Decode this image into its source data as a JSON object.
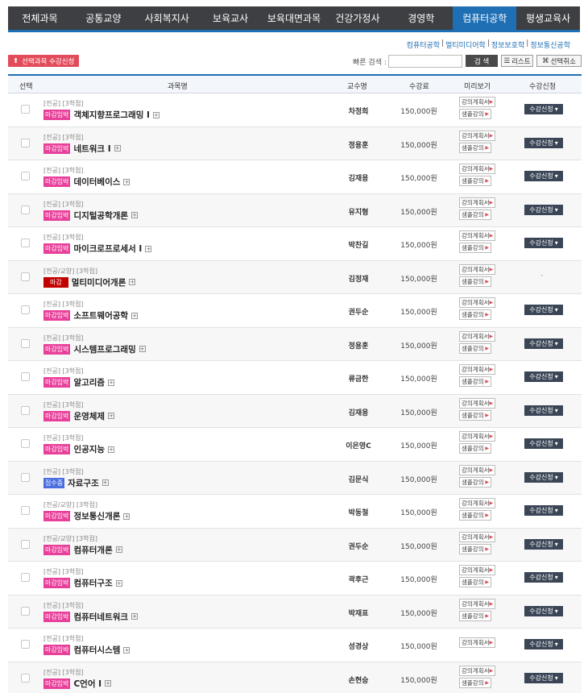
{
  "nav": {
    "tabs": [
      "전체과목",
      "공통교양",
      "사회복지사",
      "보육교사",
      "보육대면과목",
      "건강가정사",
      "경영학",
      "컴퓨터공학",
      "평생교육사"
    ],
    "active_index": 7
  },
  "subnav": {
    "links": [
      "컴퓨터공학",
      "멀티미디어학",
      "정보보호학",
      "정보통신공학"
    ]
  },
  "toolbar": {
    "enroll_selected_label": "선택과목 수강신청",
    "quick_search_label": "빠른 검색 :",
    "quick_search_value": "",
    "search_label": "검 색",
    "list_label": "리스트",
    "deselect_label": "선택취소"
  },
  "table": {
    "headers": {
      "select": "선택",
      "course": "과목명",
      "professor": "교수명",
      "fee": "수강료",
      "preview": "미리보기",
      "enroll": "수강신청"
    },
    "preview_labels": {
      "plan": "강의계획서",
      "sample": "샘플강의"
    },
    "enroll_label": "수강신청",
    "rows": [
      {
        "cat": "[전공] [3학점]",
        "badge": "마감임박",
        "badge_color": "pink",
        "name": "객체지향프로그래밍 I",
        "prof": "차정희",
        "fee": "150,000원",
        "sample": true,
        "enroll": true
      },
      {
        "cat": "[전공] [3학점]",
        "badge": "마감임박",
        "badge_color": "pink",
        "name": "네트워크 I",
        "prof": "정용훈",
        "fee": "150,000원",
        "sample": true,
        "enroll": true
      },
      {
        "cat": "[전공] [3학점]",
        "badge": "마감임박",
        "badge_color": "pink",
        "name": "데이터베이스",
        "prof": "김재용",
        "fee": "150,000원",
        "sample": true,
        "enroll": true
      },
      {
        "cat": "[전공] [3학점]",
        "badge": "마감임박",
        "badge_color": "pink",
        "name": "디지털공학개론",
        "prof": "유지형",
        "fee": "150,000원",
        "sample": true,
        "enroll": true
      },
      {
        "cat": "[전공] [3학점]",
        "badge": "마감임박",
        "badge_color": "pink",
        "name": "마이크로프로세서 I",
        "prof": "박찬길",
        "fee": "150,000원",
        "sample": true,
        "enroll": true
      },
      {
        "cat": "[전공/교양] [3학점]",
        "badge": "마감",
        "badge_color": "red",
        "name": "멀티미디어개론",
        "prof": "김정재",
        "fee": "150,000원",
        "sample": true,
        "enroll": false
      },
      {
        "cat": "[전공] [3학점]",
        "badge": "마감임박",
        "badge_color": "pink",
        "name": "소프트웨어공학",
        "prof": "권두순",
        "fee": "150,000원",
        "sample": true,
        "enroll": true
      },
      {
        "cat": "[전공] [3학점]",
        "badge": "마감임박",
        "badge_color": "pink",
        "name": "시스템프로그래밍",
        "prof": "정용훈",
        "fee": "150,000원",
        "sample": true,
        "enroll": true
      },
      {
        "cat": "[전공] [3학점]",
        "badge": "마감임박",
        "badge_color": "pink",
        "name": "알고리즘",
        "prof": "류금한",
        "fee": "150,000원",
        "sample": true,
        "enroll": true
      },
      {
        "cat": "[전공] [3학점]",
        "badge": "마감임박",
        "badge_color": "pink",
        "name": "운영체제",
        "prof": "김재용",
        "fee": "150,000원",
        "sample": true,
        "enroll": true
      },
      {
        "cat": "[전공] [3학점]",
        "badge": "마감임박",
        "badge_color": "pink",
        "name": "인공지능",
        "prof": "이은영C",
        "fee": "150,000원",
        "sample": true,
        "enroll": true
      },
      {
        "cat": "[전공] [3학점]",
        "badge": "접수중",
        "badge_color": "blue",
        "name": "자료구조",
        "prof": "김문식",
        "fee": "150,000원",
        "sample": true,
        "enroll": true
      },
      {
        "cat": "[전공/교양] [3학점]",
        "badge": "마감임박",
        "badge_color": "pink",
        "name": "정보통신개론",
        "prof": "박동철",
        "fee": "150,000원",
        "sample": true,
        "enroll": true
      },
      {
        "cat": "[전공/교양] [3학점]",
        "badge": "마감임박",
        "badge_color": "pink",
        "name": "컴퓨터개론",
        "prof": "권두순",
        "fee": "150,000원",
        "sample": true,
        "enroll": true
      },
      {
        "cat": "[전공] [3학점]",
        "badge": "마감임박",
        "badge_color": "pink",
        "name": "컴퓨터구조",
        "prof": "곽후근",
        "fee": "150,000원",
        "sample": true,
        "enroll": true
      },
      {
        "cat": "[전공] [3학점]",
        "badge": "마감임박",
        "badge_color": "pink",
        "name": "컴퓨터네트워크",
        "prof": "박재표",
        "fee": "150,000원",
        "sample": true,
        "enroll": true
      },
      {
        "cat": "[전공] [3학점]",
        "badge": "마감임박",
        "badge_color": "pink",
        "name": "컴퓨터시스템",
        "prof": "성경상",
        "fee": "150,000원",
        "sample": false,
        "enroll": true
      },
      {
        "cat": "[전공] [3학점]",
        "badge": "마감임박",
        "badge_color": "pink",
        "name": "C언어 I",
        "prof": "손현승",
        "fee": "150,000원",
        "sample": true,
        "enroll": true
      }
    ]
  },
  "colors": {
    "nav_bg": "#3d3f42",
    "nav_active": "#1f6fb5",
    "badge_pink": "#e8409a",
    "badge_red": "#c20000",
    "badge_blue": "#4a6de0",
    "enroll_btn": "#3a4556"
  },
  "icons": {
    "enroll_selected": "upload-icon",
    "list": "list-icon",
    "deselect": "deselect-icon",
    "expand": "plus-box-icon",
    "dropdown": "chevron-down-icon",
    "link_arrow": "triangle-right-icon"
  }
}
